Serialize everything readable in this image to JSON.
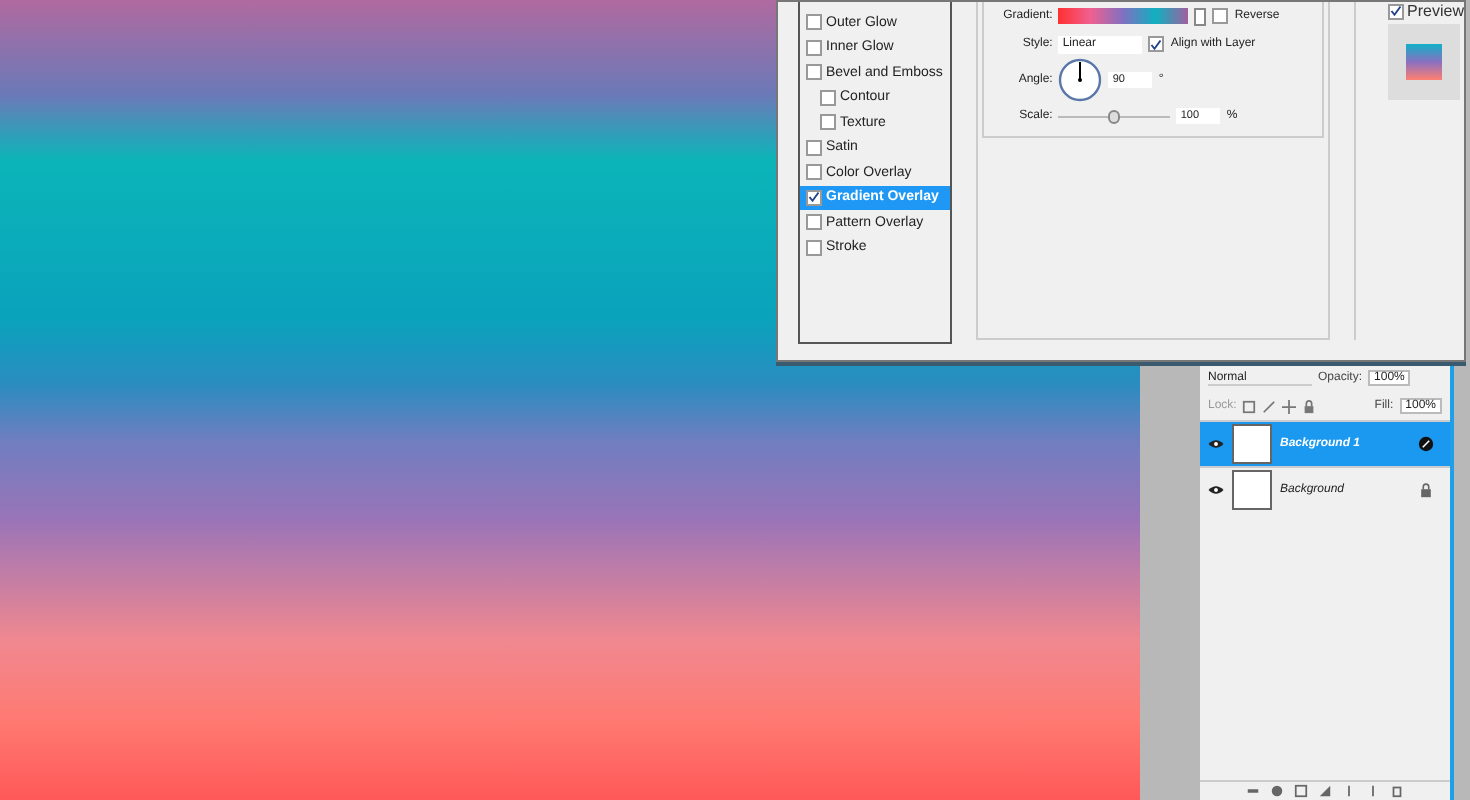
{
  "style_list": [
    {
      "label": "Outer Glow",
      "checked": false,
      "selected": false
    },
    {
      "label": "Inner Glow",
      "checked": false,
      "selected": false
    },
    {
      "label": "Bevel and Emboss",
      "checked": false,
      "selected": false,
      "children": [
        {
          "label": "Contour",
          "checked": false,
          "selected": false
        },
        {
          "label": "Texture",
          "checked": false,
          "selected": false
        }
      ]
    },
    {
      "label": "Satin",
      "checked": false,
      "selected": false
    },
    {
      "label": "Color Overlay",
      "checked": false,
      "selected": false
    },
    {
      "label": "Gradient Overlay",
      "checked": true,
      "selected": true
    },
    {
      "label": "Pattern Overlay",
      "checked": false,
      "selected": false
    },
    {
      "label": "Stroke",
      "checked": false,
      "selected": false
    }
  ],
  "gradient_overlay": {
    "gradient_label": "Gradient:",
    "reverse": {
      "label": "Reverse",
      "checked": false
    },
    "style": {
      "label": "Style:",
      "value": "Linear"
    },
    "align": {
      "label": "Align with Layer",
      "checked": true
    },
    "angle": {
      "label": "Angle:",
      "value": "90",
      "unit": "°"
    },
    "scale": {
      "label": "Scale:",
      "value": "100",
      "unit": "%",
      "level": 0.5
    }
  },
  "preview": {
    "label": "Preview",
    "checked": true
  },
  "layers_panel": {
    "blend_mode": "Normal",
    "opacity_label": "Opacity:",
    "opacity": "100%",
    "lock_label": "Lock:",
    "fill_label": "Fill:",
    "fill": "100%",
    "layers": [
      {
        "name": "Background 1",
        "selected": true,
        "visible": true,
        "kind": "effects"
      },
      {
        "name": "Background",
        "selected": false,
        "visible": true,
        "kind": "locked"
      }
    ]
  }
}
